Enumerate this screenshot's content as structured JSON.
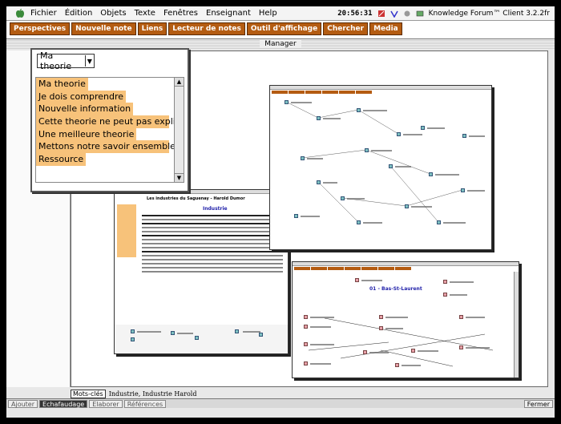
{
  "menubar": {
    "items": [
      "Fichier",
      "Édition",
      "Objets",
      "Texte",
      "Fenêtres",
      "Enseignant",
      "Help"
    ],
    "clock": "20:56:31",
    "app_name": "Knowledge Forum™ Client 3.2.2fr"
  },
  "toolbar": {
    "buttons": [
      "Perspectives",
      "Nouvelle note",
      "Liens",
      "Lecteur de notes",
      "Outil d'affichage",
      "Chercher",
      "Media"
    ]
  },
  "manager": {
    "title": "Manager"
  },
  "scaffold": {
    "selected": "Ma theorie",
    "items": [
      "Ma theorie",
      "Je dois comprendre",
      "Nouvelle information",
      "Cette theorie ne peut pas expliquer",
      "Une meilleure theorie",
      "Mettons notre savoir ensemble",
      "Ressource"
    ]
  },
  "bottom": {
    "keywords_label": "Mots-clés",
    "keywords_value": "Industrie, Industrie Harold",
    "add_label": "Ajouter",
    "tabs": [
      "Echafaudage",
      "Elaborer",
      "Références"
    ],
    "close_label": "Fermer"
  },
  "thumbnails": {
    "doc_title": "Les industries du Saguenay - Harold Dumor",
    "doc_heading": "Industrie",
    "map_title": "01 - Bas-St-Laurent"
  }
}
